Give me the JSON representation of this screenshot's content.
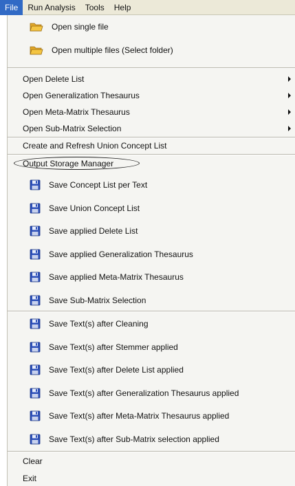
{
  "menubar": {
    "items": [
      "File",
      "Run Analysis",
      "Tools",
      "Help"
    ]
  },
  "file_menu": {
    "open_single": "Open single file",
    "open_multiple": "Open multiple files (Select folder)",
    "open_delete_list": "Open Delete List",
    "open_generalization": "Open Generalization Thesaurus",
    "open_meta_matrix": "Open Meta-Matrix Thesaurus",
    "open_sub_matrix": "Open Sub-Matrix Selection",
    "create_union": "Create and Refresh Union Concept List",
    "output_storage": "Output Storage Manager",
    "save_items": [
      "Save Concept List per Text",
      "Save Union Concept List",
      "Save applied Delete List",
      "Save applied Generalization Thesaurus",
      "Save applied Meta-Matrix Thesaurus",
      "Save Sub-Matrix Selection"
    ],
    "save_text_items": [
      "Save Text(s) after Cleaning",
      "Save Text(s) after Stemmer applied",
      "Save Text(s) after Delete List applied",
      "Save Text(s) after Generalization Thesaurus applied",
      "Save Text(s) after Meta-Matrix Thesaurus applied",
      "Save Text(s) after Sub-Matrix selection applied"
    ],
    "clear": "Clear",
    "exit": "Exit"
  },
  "colors": {
    "menubar_bg": "#ece9d8",
    "active_menu": "#316ac5",
    "menu_bg": "#f5f5f2",
    "floppy_blue": "#2c4fb8",
    "folder_yellow": "#f4c542"
  },
  "icons": {
    "open": "folder-icon",
    "save": "floppy-disk-icon",
    "submenu": "submenu-arrow-icon"
  }
}
